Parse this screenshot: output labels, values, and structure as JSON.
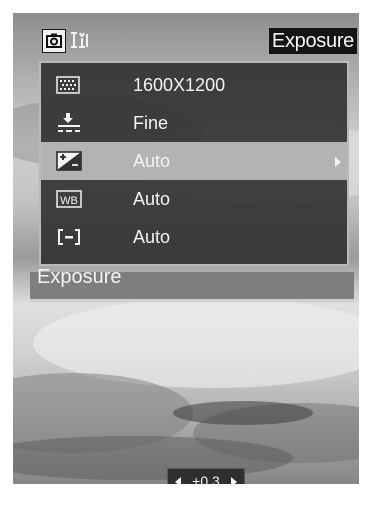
{
  "header": {
    "tabs": [
      {
        "icon": "camera-icon",
        "selected": true
      },
      {
        "icon": "setup-tools-icon",
        "selected": false
      }
    ],
    "title": "Exposure"
  },
  "menu": {
    "items": [
      {
        "icon": "image-size-icon",
        "value": "1600X1200",
        "selected": false
      },
      {
        "icon": "quality-icon",
        "value": "Fine",
        "selected": false
      },
      {
        "icon": "exposure-compensation-icon",
        "value": "Auto",
        "selected": true
      },
      {
        "icon": "white-balance-icon",
        "value": "Auto",
        "selected": false
      },
      {
        "icon": "metering-icon",
        "value": "Auto",
        "selected": false
      }
    ]
  },
  "label_bar": {
    "text": "Exposure"
  },
  "ev_adjust": {
    "value": "+0.3"
  },
  "colors": {
    "menu_bg": "#303030",
    "highlight": "#b3b3b3",
    "text": "#f4f4f4",
    "title_bg": "#141414"
  }
}
